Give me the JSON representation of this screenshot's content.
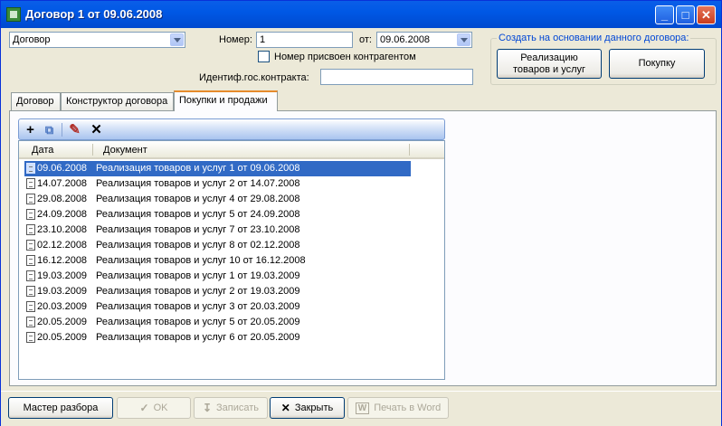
{
  "window": {
    "title": "Договор 1 от 09.06.2008",
    "minimize_glyph": "_",
    "maximize_glyph": "□",
    "close_glyph": "✕"
  },
  "form": {
    "type_value": "Договор",
    "number_label": "Номер:",
    "number_value": "1",
    "from_label": "от:",
    "date_value": "09.06.2008",
    "assigned_checkbox_label": "Номер присвоен контрагентом",
    "assigned_checked": false,
    "gov_contract_label": "Идентиф.гос.контракта:",
    "gov_contract_value": ""
  },
  "create_based": {
    "title": "Создать на основании данного договора:",
    "sales_button_line1": "Реализацию",
    "sales_button_line2": "товаров и услуг",
    "purchase_button": "Покупку"
  },
  "tabs": [
    {
      "label": "Договор",
      "active": false
    },
    {
      "label": "Конструктор договора",
      "active": false
    },
    {
      "label": "Покупки и продажи",
      "active": true
    }
  ],
  "toolbar": {
    "add_glyph": "+",
    "copy_glyph": "⧉",
    "edit_glyph": "✎",
    "delete_glyph": "✕"
  },
  "list": {
    "columns": [
      "Дата",
      "Документ"
    ],
    "rows": [
      {
        "date": "09.06.2008",
        "document": "Реализация товаров и услуг 1 от 09.06.2008",
        "selected": true
      },
      {
        "date": "14.07.2008",
        "document": "Реализация товаров и услуг 2 от 14.07.2008"
      },
      {
        "date": "29.08.2008",
        "document": "Реализация товаров и услуг 4 от 29.08.2008"
      },
      {
        "date": "24.09.2008",
        "document": "Реализация товаров и услуг 5 от 24.09.2008"
      },
      {
        "date": "23.10.2008",
        "document": "Реализация товаров и услуг 7 от 23.10.2008"
      },
      {
        "date": "02.12.2008",
        "document": "Реализация товаров и услуг 8 от 02.12.2008"
      },
      {
        "date": "16.12.2008",
        "document": "Реализация товаров и услуг 10 от 16.12.2008"
      },
      {
        "date": "19.03.2009",
        "document": "Реализация товаров и услуг 1 от 19.03.2009"
      },
      {
        "date": "19.03.2009",
        "document": "Реализация товаров и услуг 2 от 19.03.2009"
      },
      {
        "date": "20.03.2009",
        "document": "Реализация товаров и услуг 3 от 20.03.2009"
      },
      {
        "date": "20.05.2009",
        "document": "Реализация товаров и услуг 5 от 20.05.2009"
      },
      {
        "date": "20.05.2009",
        "document": "Реализация товаров и услуг 6 от 20.05.2009"
      }
    ]
  },
  "bottom": {
    "wizard": "Мастер разбора",
    "ok": "OK",
    "ok_glyph": "✓",
    "save": "Записать",
    "save_glyph": "↧",
    "close": "Закрыть",
    "close_glyph": "✕",
    "print_word": "Печать в Word",
    "print_glyph": "W"
  },
  "colors": {
    "titlebar": "#0058e5",
    "selection": "#316ac5",
    "active_tab_accent": "#e68b2c",
    "group_title": "#0046d5"
  }
}
